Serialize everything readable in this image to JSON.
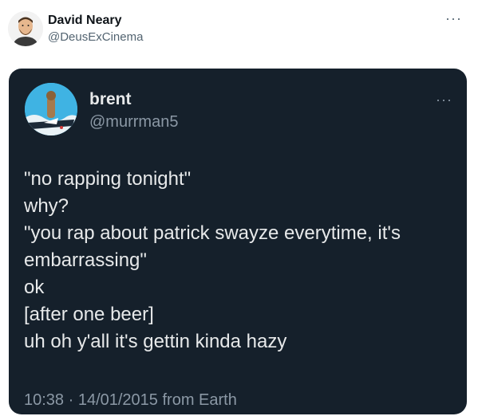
{
  "outer": {
    "name": "David Neary",
    "handle": "@DeusExCinema",
    "more": "···"
  },
  "quoted": {
    "name": "brent",
    "handle": "@murrman5",
    "more": "···",
    "lines": [
      "\"no rapping tonight\"",
      "why?",
      "\"you rap about patrick swayze everytime, it's",
      "embarrassing\"",
      "ok",
      "[after one beer]",
      "uh oh y'all it's gettin kinda hazy"
    ],
    "meta": "10:38 · 14/01/2015 from Earth"
  },
  "colors": {
    "card_bg": "#15202b",
    "text_primary": "#e7e9ea",
    "text_secondary": "#8b98a5"
  }
}
